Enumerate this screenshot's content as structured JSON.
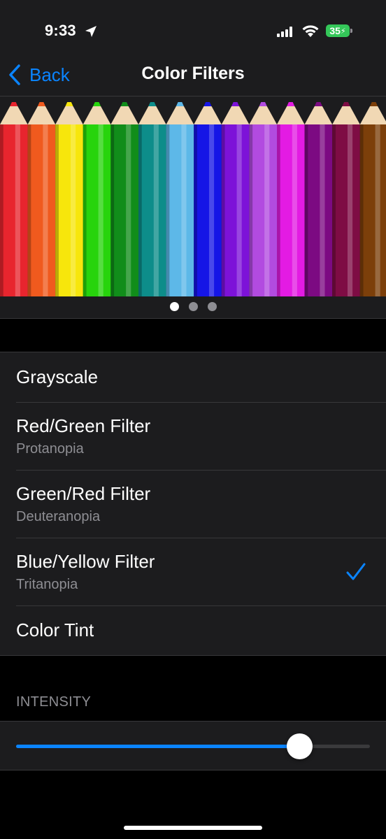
{
  "status_bar": {
    "time": "9:33",
    "battery": "35",
    "battery_color": "#34c759"
  },
  "nav": {
    "back_label": "Back",
    "title": "Color Filters"
  },
  "preview": {
    "pencil_colors": [
      "#e8252e",
      "#f05a1e",
      "#f7e60c",
      "#27d40c",
      "#118d1a",
      "#0d8d8a",
      "#5db8e8",
      "#1515e6",
      "#7d12d8",
      "#b24be0",
      "#e31be3",
      "#7c0a82",
      "#7e0c44",
      "#7c3f0a"
    ],
    "page_count": 3,
    "active_page": 0
  },
  "filters": [
    {
      "label": "Grayscale",
      "sublabel": "",
      "selected": false
    },
    {
      "label": "Red/Green Filter",
      "sublabel": "Protanopia",
      "selected": false
    },
    {
      "label": "Green/Red Filter",
      "sublabel": "Deuteranopia",
      "selected": false
    },
    {
      "label": "Blue/Yellow Filter",
      "sublabel": "Tritanopia",
      "selected": true
    },
    {
      "label": "Color Tint",
      "sublabel": "",
      "selected": false
    }
  ],
  "intensity": {
    "header": "INTENSITY",
    "value": 0.8
  },
  "colors": {
    "accent": "#0a84ff",
    "background": "#000000",
    "cell": "#1c1c1e"
  }
}
